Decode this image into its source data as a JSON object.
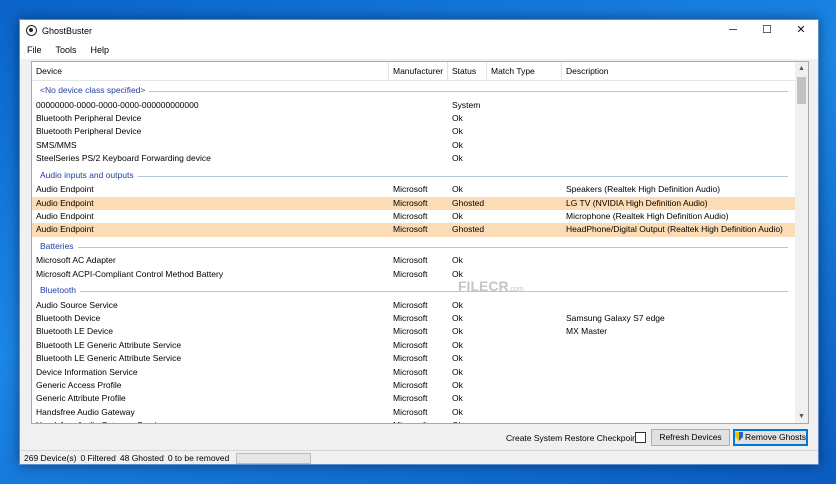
{
  "window": {
    "title": "GhostBuster",
    "minimize": "─",
    "maximize": "☐",
    "close": "✕"
  },
  "menu": [
    "File",
    "Tools",
    "Help"
  ],
  "columns": [
    "Device",
    "Manufacturer",
    "Status",
    "Match Type",
    "Description"
  ],
  "groups": [
    {
      "label": "<No device class specified>",
      "rows": [
        {
          "device": "00000000-0000-0000-0000-000000000000",
          "manufacturer": "",
          "status": "System",
          "match": "",
          "description": ""
        },
        {
          "device": "Bluetooth Peripheral Device",
          "manufacturer": "",
          "status": "Ok",
          "match": "",
          "description": ""
        },
        {
          "device": "Bluetooth Peripheral Device",
          "manufacturer": "",
          "status": "Ok",
          "match": "",
          "description": ""
        },
        {
          "device": "SMS/MMS",
          "manufacturer": "",
          "status": "Ok",
          "match": "",
          "description": ""
        },
        {
          "device": "SteelSeries PS/2 Keyboard Forwarding device",
          "manufacturer": "",
          "status": "Ok",
          "match": "",
          "description": ""
        }
      ]
    },
    {
      "label": "Audio inputs and outputs",
      "rows": [
        {
          "device": "Audio Endpoint",
          "manufacturer": "Microsoft",
          "status": "Ok",
          "match": "",
          "description": "Speakers (Realtek High Definition Audio)"
        },
        {
          "device": "Audio Endpoint",
          "manufacturer": "Microsoft",
          "status": "Ghosted",
          "match": "",
          "description": "LG TV (NVIDIA High Definition Audio)",
          "ghosted": true
        },
        {
          "device": "Audio Endpoint",
          "manufacturer": "Microsoft",
          "status": "Ok",
          "match": "",
          "description": "Microphone (Realtek High Definition Audio)"
        },
        {
          "device": "Audio Endpoint",
          "manufacturer": "Microsoft",
          "status": "Ghosted",
          "match": "",
          "description": "HeadPhone/Digital Output (Realtek High Definition Audio)",
          "ghosted": true
        }
      ]
    },
    {
      "label": "Batteries",
      "rows": [
        {
          "device": "Microsoft AC Adapter",
          "manufacturer": "Microsoft",
          "status": "Ok",
          "match": "",
          "description": ""
        },
        {
          "device": "Microsoft ACPI-Compliant Control Method Battery",
          "manufacturer": "Microsoft",
          "status": "Ok",
          "match": "",
          "description": ""
        }
      ]
    },
    {
      "label": "Bluetooth",
      "rows": [
        {
          "device": "Audio Source Service",
          "manufacturer": "Microsoft",
          "status": "Ok",
          "match": "",
          "description": ""
        },
        {
          "device": "Bluetooth Device",
          "manufacturer": "Microsoft",
          "status": "Ok",
          "match": "",
          "description": "Samsung Galaxy S7 edge"
        },
        {
          "device": "Bluetooth LE Device",
          "manufacturer": "Microsoft",
          "status": "Ok",
          "match": "",
          "description": "MX Master"
        },
        {
          "device": "Bluetooth LE Generic Attribute Service",
          "manufacturer": "Microsoft",
          "status": "Ok",
          "match": "",
          "description": ""
        },
        {
          "device": "Bluetooth LE Generic Attribute Service",
          "manufacturer": "Microsoft",
          "status": "Ok",
          "match": "",
          "description": ""
        },
        {
          "device": "Device Information Service",
          "manufacturer": "Microsoft",
          "status": "Ok",
          "match": "",
          "description": ""
        },
        {
          "device": "Generic Access Profile",
          "manufacturer": "Microsoft",
          "status": "Ok",
          "match": "",
          "description": ""
        },
        {
          "device": "Generic Attribute Profile",
          "manufacturer": "Microsoft",
          "status": "Ok",
          "match": "",
          "description": ""
        },
        {
          "device": "Handsfree Audio Gateway",
          "manufacturer": "Microsoft",
          "status": "Ok",
          "match": "",
          "description": ""
        },
        {
          "device": "Handsfree Audio Gateway Service",
          "manufacturer": "Microsoft",
          "status": "Ok",
          "match": "",
          "description": ""
        }
      ]
    }
  ],
  "controls": {
    "restore_checkpoint_label": "Create System Restore Checkpoint",
    "refresh_label": "Refresh Devices",
    "remove_label": "Remove Ghosts"
  },
  "status": {
    "devices": "269 Device(s)",
    "filtered": "0 Filtered",
    "ghosted": "48 Ghosted",
    "to_remove": "0 to be removed"
  },
  "watermark": {
    "main": "FILECR",
    "sub": ".com"
  },
  "colors": {
    "ghosted_row": "#fbdcb4",
    "group_label": "#1f3f9f"
  }
}
